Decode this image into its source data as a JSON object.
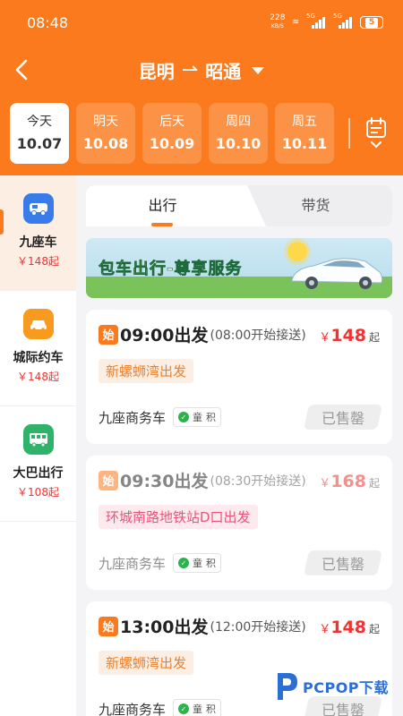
{
  "status": {
    "time": "08:48",
    "speed_value": "228",
    "speed_unit": "KB/S",
    "net1": "5G",
    "net2": "5G",
    "battery": "5"
  },
  "header": {
    "from": "昆明",
    "arrow": "⇀",
    "to": "昭通"
  },
  "dates": [
    {
      "day": "今天",
      "date": "10.07",
      "active": true
    },
    {
      "day": "明天",
      "date": "10.08",
      "active": false
    },
    {
      "day": "后天",
      "date": "10.09",
      "active": false
    },
    {
      "day": "周四",
      "date": "10.10",
      "active": false
    },
    {
      "day": "周五",
      "date": "10.11",
      "active": false
    }
  ],
  "sidebar": {
    "items": [
      {
        "label": "九座车",
        "price": "￥148起",
        "color": "#3a7bea"
      },
      {
        "label": "城际约车",
        "price": "￥148起",
        "color": "#f79a1e"
      },
      {
        "label": "大巴出行",
        "price": "￥108起",
        "color": "#2fb36a"
      }
    ]
  },
  "tabs": {
    "left": "出行",
    "right": "带货"
  },
  "banner": {
    "part1": "包车",
    "part2": "出行",
    "part3": "-尊享服务"
  },
  "cards": [
    {
      "badge": "始",
      "depart": "09:00出发",
      "pickup": "(08:00开始接送)",
      "yen": "￥",
      "price": "148",
      "qi": "起",
      "location": "新螺蛳湾出发",
      "vehicle": "九座商务车",
      "tag1": "童",
      "tag2": "积",
      "status": "已售罄"
    },
    {
      "badge": "始",
      "depart": "09:30出发",
      "pickup": "(08:30开始接送)",
      "yen": "￥",
      "price": "168",
      "qi": "起",
      "location": "环城南路地铁站D口出发",
      "vehicle": "九座商务车",
      "tag1": "童",
      "tag2": "积",
      "status": "已售罄"
    },
    {
      "badge": "始",
      "depart": "13:00出发",
      "pickup": "(12:00开始接送)",
      "yen": "￥",
      "price": "148",
      "qi": "起",
      "location": "新螺蛳湾出发",
      "vehicle": "九座商务车",
      "tag1": "童",
      "tag2": "积",
      "status": "已售罄"
    }
  ],
  "watermark": {
    "text": "PCPOP下载"
  }
}
